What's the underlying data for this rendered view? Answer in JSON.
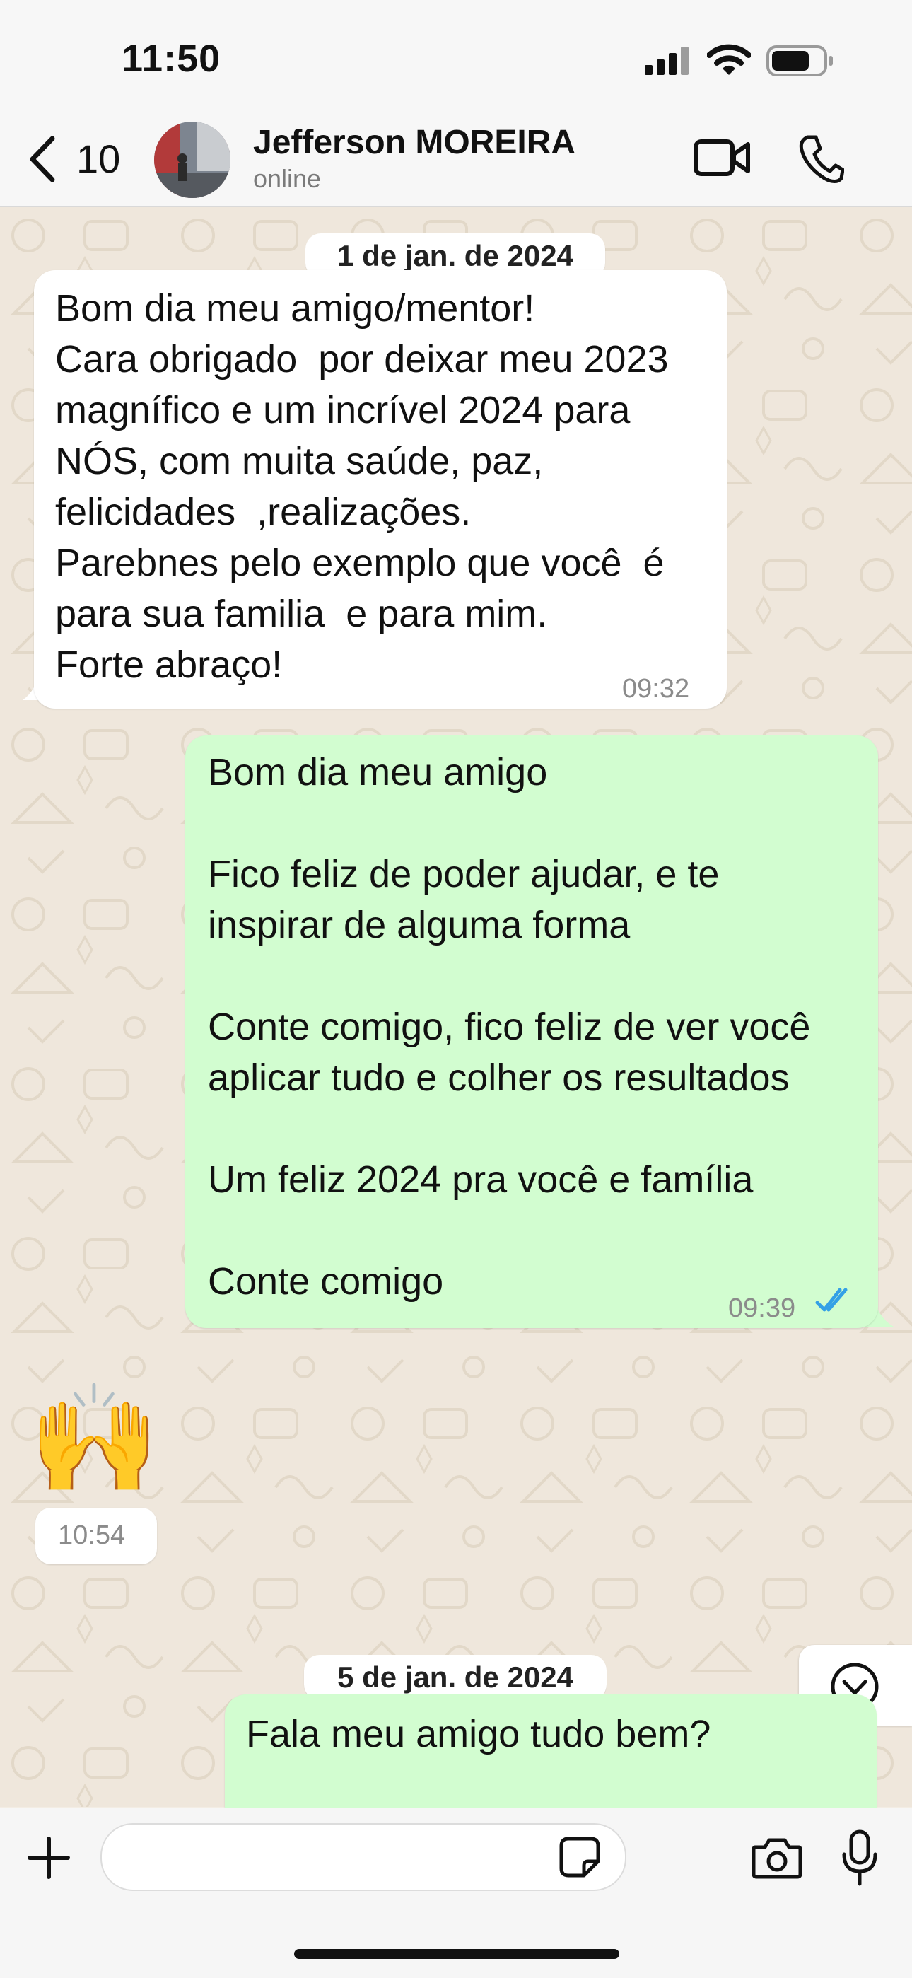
{
  "status_bar": {
    "time": "11:50",
    "icons": [
      "signal-icon",
      "wifi-icon",
      "battery-icon"
    ]
  },
  "header": {
    "back_count": "10",
    "contact_name": "Jefferson MOREIRA",
    "contact_status": "online",
    "icons": [
      "chevron-left-icon",
      "video-call-icon",
      "phone-icon"
    ]
  },
  "messages": [
    {
      "type": "date",
      "text": "1 de jan. de 2024"
    },
    {
      "type": "incoming",
      "text": "Bom dia meu amigo/mentor!\nCara obrigado  por deixar meu 2023\nmagnífico e um incrível 2024 para\nNÓS, com muita saúde, paz,\nfelicidades  ,realizações.\nParebnes pelo exemplo que você  é\npara sua familia  e para mim.\nForte abraço!",
      "time": "09:32"
    },
    {
      "type": "outgoing",
      "text": "Bom dia meu amigo\n\nFico feliz de poder ajudar, e te\ninspirar de alguma forma\n\nConte comigo, fico feliz de ver você\naplicar tudo e colher os resultados\n\nUm feliz 2024 pra você e família\n\nConte comigo",
      "time": "09:39",
      "status": "read"
    },
    {
      "type": "incoming-emoji",
      "emoji": "🙌",
      "time": "10:54"
    },
    {
      "type": "date",
      "text": "5 de jan. de 2024"
    },
    {
      "type": "outgoing",
      "text": "Fala meu amigo tudo bem?"
    }
  ],
  "composer": {
    "placeholder": "",
    "icons": [
      "plus-icon",
      "sticker-icon",
      "camera-icon",
      "microphone-icon"
    ]
  },
  "colors": {
    "incoming_bubble": "#ffffff",
    "outgoing_bubble": "#d2fdd0",
    "read_ticks": "#34a0e6",
    "chat_background": "#efe7dc"
  }
}
